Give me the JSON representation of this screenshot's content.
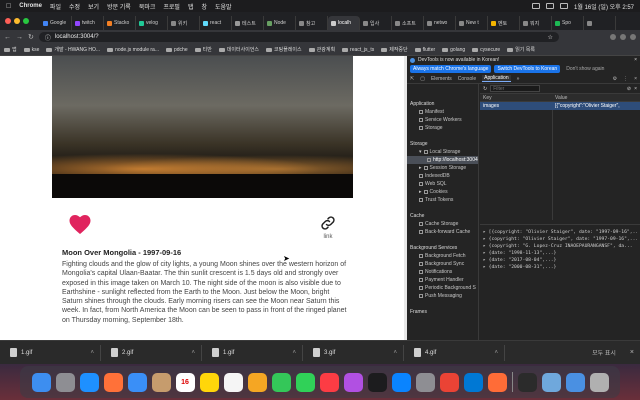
{
  "menubar": {
    "app": "Chrome",
    "items": [
      "파일",
      "수정",
      "보기",
      "방문 기록",
      "북마크",
      "프로필",
      "탭",
      "창",
      "도움말"
    ],
    "clock": "1월 16일 (일) 오후 2:57"
  },
  "tabs": [
    {
      "label": "Google",
      "color": "#4285f4"
    },
    {
      "label": "twitch",
      "color": "#9146ff"
    },
    {
      "label": "Stacko",
      "color": "#f48024"
    },
    {
      "label": "velog",
      "color": "#20c997"
    },
    {
      "label": "위키",
      "color": "#888888"
    },
    {
      "label": "react",
      "color": "#61dafb"
    },
    {
      "label": "테스트",
      "color": "#999999"
    },
    {
      "label": "Node",
      "color": "#68a063"
    },
    {
      "label": "참고",
      "color": "#888888"
    },
    {
      "label": "localh",
      "color": "#cccccc",
      "active": true
    },
    {
      "label": "입사",
      "color": "#888888"
    },
    {
      "label": "소프트",
      "color": "#888888"
    },
    {
      "label": "netwo",
      "color": "#888888"
    },
    {
      "label": "New t",
      "color": "#888888"
    },
    {
      "label": "멘토",
      "color": "#f4b400"
    },
    {
      "label": "뭐지",
      "color": "#888888"
    },
    {
      "label": "Spo",
      "color": "#1db954"
    },
    {
      "label": "",
      "color": "#888888"
    }
  ],
  "address": {
    "url": "localhost:3004/?"
  },
  "bookmarks": [
    "앱",
    "kse",
    "개발 - HWANG HO...",
    "node.js module ra...",
    "pdche",
    "티반",
    "데이터사이언스",
    "코팅플레이스",
    "관광계획",
    "react_js_ts",
    "제작중단",
    "flutter",
    "golang",
    "cysecure",
    "읽기 목록"
  ],
  "apod": {
    "title": "Moon Over Mongolia - 1997-09-16",
    "description": "Fighting clouds and the glow of city lights, a young Moon shines over the western horizon of Mongolia's capital Ulaan-Baatar. The thin sunlit crescent is 1.5 days old and strongly over exposed in this image taken on March 10. The night side of the moon is also visible due to Earthshine - sunlight reflected from the Earth to the Moon. Just below the Moon, bright Saturn shines through the clouds. Early morning risers can see the Moon near Saturn this week. In fact, from North America the Moon can be seen to pass in front of the ringed planet on Thursday morning, September 18th.",
    "link_label": "link"
  },
  "devtools": {
    "banner": "DevTools is now available in Korean!",
    "btn_match": "Always match Chrome's language",
    "btn_switch": "Switch DevTools to Korean",
    "btn_dont": "Don't show again",
    "tabs": [
      "Elements",
      "Console",
      "Application",
      "»"
    ],
    "active_tab": "Application",
    "filter_placeholder": "Filter",
    "section_application": "Application",
    "app_items": [
      "Manifest",
      "Service Workers",
      "Storage"
    ],
    "section_storage": "Storage",
    "local_storage": "Local Storage",
    "local_origin": "http://localhost:3004",
    "storage_items": [
      "Session Storage",
      "IndexedDB",
      "Web SQL",
      "Cookies",
      "Trust Tokens"
    ],
    "section_cache": "Cache",
    "cache_items": [
      "Cache Storage",
      "Back-forward Cache"
    ],
    "section_background": "Background Services",
    "bg_items": [
      "Background Fetch",
      "Background Sync",
      "Notifications",
      "Payment Handler",
      "Periodic Background S",
      "Push Messaging"
    ],
    "section_frames": "Frames",
    "col_key": "Key",
    "col_value": "Value",
    "row_key": "images",
    "row_value": "[{\"copyright\":\"Olivier Staiger\",",
    "console_lines": [
      "▸ [{copyright: \"Olivier Staiger\", date: \"1997-09-16\",...",
      "▸ {copyright: \"Olivier Staiger\", date: \"1997-09-16\",...",
      "▸ {copyright: \"G. Lopez-Cruz INAOEPAURANGANSF\", da...",
      "▸ {date: \"1998-11-13\",...}",
      "▸ {date: \"2017-08-04\",...}",
      "▸ {date: \"2000-08-31\",...}"
    ]
  },
  "downloads": [
    "1.gif",
    "2.gif",
    "1.gif",
    "3.gif",
    "4.gif"
  ],
  "downloads_showall": "모두 표시",
  "dock": [
    {
      "name": "Finder",
      "color": "#3d8ef0"
    },
    {
      "name": "Launchpad",
      "color": "#8e8e93"
    },
    {
      "name": "Safari",
      "color": "#1e90ff"
    },
    {
      "name": "Firefox",
      "color": "#ff7139"
    },
    {
      "name": "Mail",
      "color": "#3a8ff7"
    },
    {
      "name": "Contacts",
      "color": "#c69c6d"
    },
    {
      "name": "Calendar",
      "color": "#ffffff"
    },
    {
      "name": "Notes",
      "color": "#ffd60a"
    },
    {
      "name": "Reminders",
      "color": "#f5f5f5"
    },
    {
      "name": "Photos",
      "color": "#f5a623"
    },
    {
      "name": "Messages",
      "color": "#34c759"
    },
    {
      "name": "FaceTime",
      "color": "#30d158"
    },
    {
      "name": "Music",
      "color": "#fc3c44"
    },
    {
      "name": "Podcasts",
      "color": "#b150e2"
    },
    {
      "name": "TV",
      "color": "#1c1c1e"
    },
    {
      "name": "App Store",
      "color": "#0a84ff"
    },
    {
      "name": "System Preferences",
      "color": "#8e8e93"
    },
    {
      "name": "Chrome",
      "color": "#ea4335"
    },
    {
      "name": "VS Code",
      "color": "#0078d4"
    },
    {
      "name": "Postman",
      "color": "#ff6c37"
    },
    {
      "name": "Quick",
      "color": "#2b2b2b"
    },
    {
      "name": "Preview",
      "color": "#6fa8dc"
    },
    {
      "name": "Downloads",
      "color": "#4a90e2"
    },
    {
      "name": "Trash",
      "color": "#b0b0b0"
    }
  ],
  "calendar_day": "16",
  "colors": {
    "heart": "#e0245e",
    "devtools_accent": "#1a73e8"
  }
}
